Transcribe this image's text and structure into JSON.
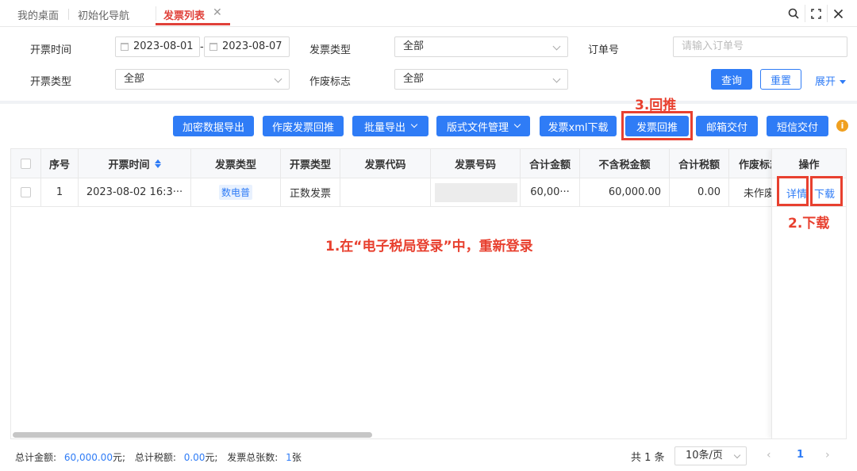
{
  "tabs": {
    "home": "我的桌面",
    "init_nav": "初始化导航",
    "active": "发票列表",
    "close": "✕"
  },
  "topbar": {
    "search": "⌕",
    "fullscreen": "⛶",
    "close": "✕"
  },
  "filters": {
    "issue_date_label": "开票时间",
    "date_start": "2023-08-01",
    "date_end": "2023-08-07",
    "date_dash": "-",
    "invoice_type_label": "发票类型",
    "invoice_type_value": "全部",
    "order_no_label": "订单号",
    "order_no_placeholder": "请输入订单号",
    "issue_type_label": "开票类型",
    "issue_type_value": "全部",
    "void_flag_label": "作废标志",
    "void_flag_value": "全部",
    "query": "查询",
    "reset": "重置",
    "expand": "展开"
  },
  "toolbar": {
    "export_encrypted": "加密数据导出",
    "void_pushback": "作废发票回推",
    "batch_export": "批量导出",
    "layout_file_mgmt": "版式文件管理",
    "xml_download": "发票xml下载",
    "invoice_pushback": "发票回推",
    "email_delivery": "邮箱交付",
    "sms_delivery": "短信交付",
    "info": "i"
  },
  "annotations": {
    "step3": "3.回推",
    "step2": "2.下载",
    "step1": "1.在“电子税局登录”中，重新登录"
  },
  "table": {
    "headers": {
      "seq": "序号",
      "issue_time": "开票时间",
      "invoice_type": "发票类型",
      "issue_type": "开票类型",
      "invoice_code": "发票代码",
      "invoice_no": "发票号码",
      "total": "合计金额",
      "amount_ex_tax": "不含税金额",
      "total_tax": "合计税额",
      "void_flag": "作废标志",
      "actions": "操作"
    },
    "rows": [
      {
        "seq": "1",
        "issue_time": "2023-08-02 16:3···",
        "invoice_type": "数电普",
        "issue_type": "正数发票",
        "invoice_code": "",
        "total": "60,00···",
        "amount_ex_tax": "60,000.00",
        "total_tax": "0.00",
        "void_flag": "未作废",
        "detail": "详情",
        "download": "下载"
      }
    ]
  },
  "footer": {
    "total_amount_label": "总计金额:",
    "total_amount": "60,000.00",
    "total_tax_label": "总计税额:",
    "total_tax": "0.00",
    "count_label": "发票总张数:",
    "count": "1",
    "yuan": "元;",
    "zhang": "张"
  },
  "pagination": {
    "total": "共 1 条",
    "page_size": "10条/页",
    "current": "1",
    "prev": "‹",
    "next": "›"
  },
  "colors": {
    "accent": "#2f7cf6",
    "annotation": "#e8402f",
    "active_tab": "#e0413a"
  }
}
